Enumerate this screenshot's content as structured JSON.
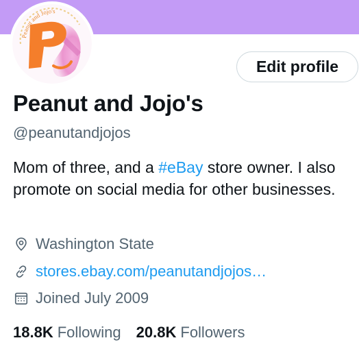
{
  "colors": {
    "banner": "#c39bf6",
    "text_primary": "#0f1419",
    "text_secondary": "#536471",
    "link": "#1d9bf0",
    "button_border": "#cfd9de",
    "avatar_logo_orange": "#f47e2b",
    "avatar_logo_pink": "#e98ac9"
  },
  "avatar": {
    "icon": "peanut-and-jojos-logo",
    "logo_letter": "P",
    "logo_arc_text": "Peanut and Jojo's"
  },
  "actions": {
    "edit_profile_label": "Edit profile"
  },
  "profile": {
    "display_name": "Peanut and Jojo's",
    "handle": "@peanutandjojos",
    "bio": {
      "part1": "Mom of three, and a ",
      "hashtag": "#eBay",
      "part2": " store owner. I also promote on social media for other businesses."
    },
    "location": {
      "icon": "location-pin-icon",
      "text": "Washington State"
    },
    "website": {
      "icon": "link-icon",
      "text": "stores.ebay.com/peanutandjojos…"
    },
    "joined": {
      "icon": "calendar-icon",
      "text": "Joined July 2009"
    }
  },
  "stats": {
    "following": {
      "count": "18.8K",
      "label": "Following"
    },
    "followers": {
      "count": "20.8K",
      "label": "Followers"
    }
  }
}
